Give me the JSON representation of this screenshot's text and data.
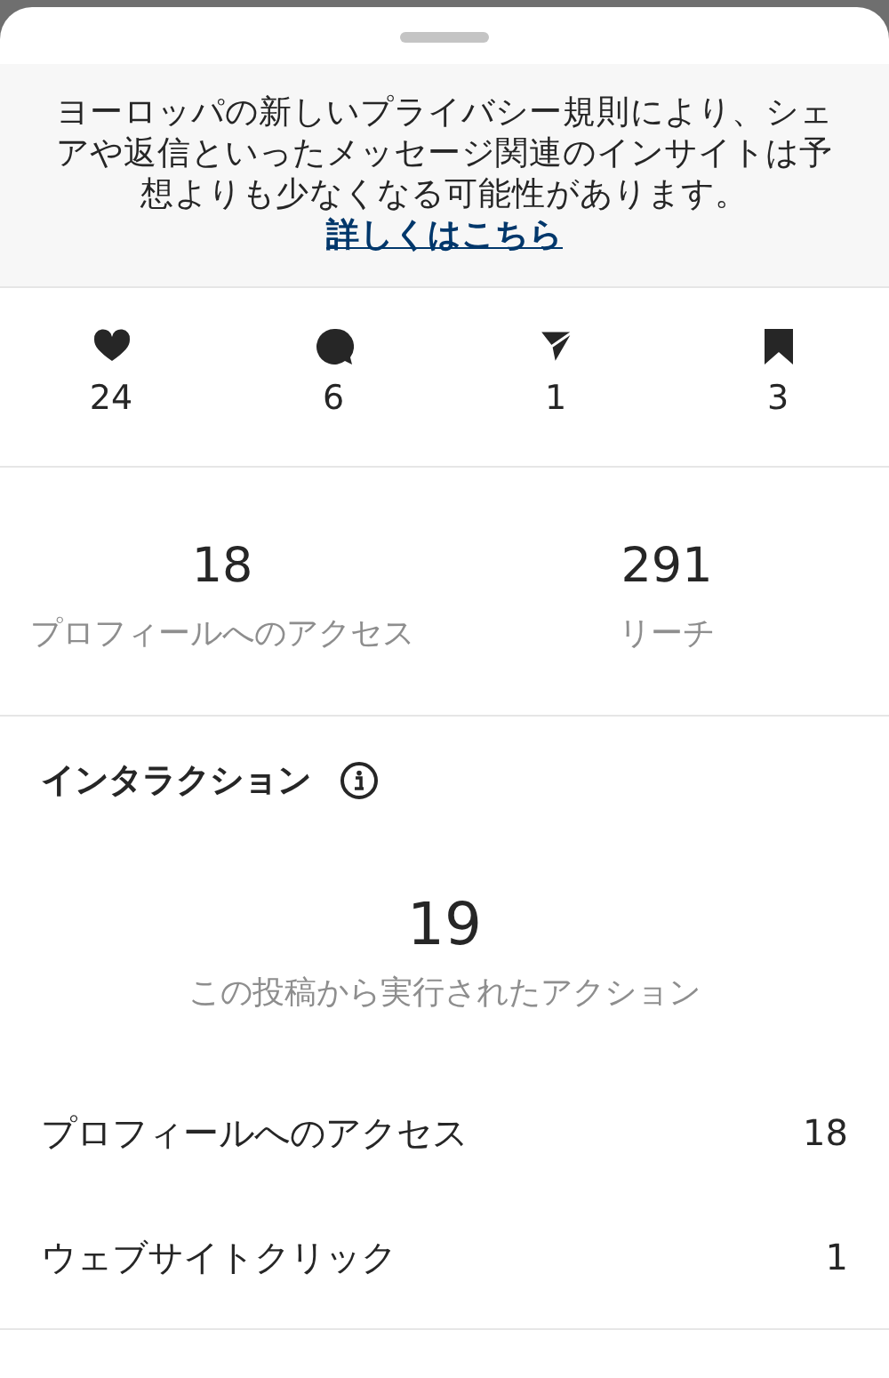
{
  "notice": {
    "text": "ヨーロッパの新しいプライバシー規則により、シェアや返信といったメッセージ関連のインサイトは予想よりも少なくなる可能性があります。",
    "link": "詳しくはこちら"
  },
  "engagement": [
    {
      "kind": "heart",
      "count": "24"
    },
    {
      "kind": "comment",
      "count": "6"
    },
    {
      "kind": "share",
      "count": "1"
    },
    {
      "kind": "save",
      "count": "3"
    }
  ],
  "stats": [
    {
      "value": "18",
      "label": "プロフィールへのアクセス"
    },
    {
      "value": "291",
      "label": "リーチ"
    }
  ],
  "interactions": {
    "title": "インタラクション",
    "total": "19",
    "total_label": "この投稿から実行されたアクション",
    "rows": [
      {
        "label": "プロフィールへのアクセス",
        "value": "18"
      },
      {
        "label": "ウェブサイトクリック",
        "value": "1"
      }
    ]
  }
}
